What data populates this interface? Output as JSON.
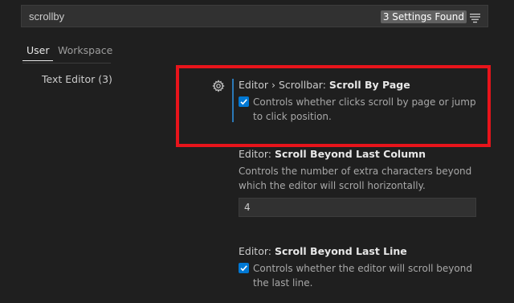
{
  "search": {
    "value": "scrollby",
    "results_badge": "3 Settings Found"
  },
  "tabs": [
    {
      "label": "User",
      "active": true
    },
    {
      "label": "Workspace",
      "active": false
    }
  ],
  "toc": {
    "items": [
      {
        "label": "Text Editor (3)"
      }
    ]
  },
  "settings": [
    {
      "category": "Editor › Scrollbar: ",
      "name": "Scroll By Page",
      "type": "checkbox",
      "checked": true,
      "description": "Controls whether clicks scroll by page or jump to click position."
    },
    {
      "category": "Editor: ",
      "name": "Scroll Beyond Last Column",
      "type": "number",
      "description": "Controls the number of extra characters beyond which the editor will scroll horizontally.",
      "value": "4"
    },
    {
      "category": "Editor: ",
      "name": "Scroll Beyond Last Line",
      "type": "checkbox",
      "checked": true,
      "description": "Controls whether the editor will scroll beyond the last line."
    }
  ],
  "colors": {
    "background": "#1f1f1f",
    "checkbox": "#0078d4",
    "highlight": "#e8141b",
    "focus_bar": "#2b79b8"
  },
  "icons": {
    "filter": "filter-icon",
    "gear": "gear-icon",
    "check": "check-icon"
  }
}
